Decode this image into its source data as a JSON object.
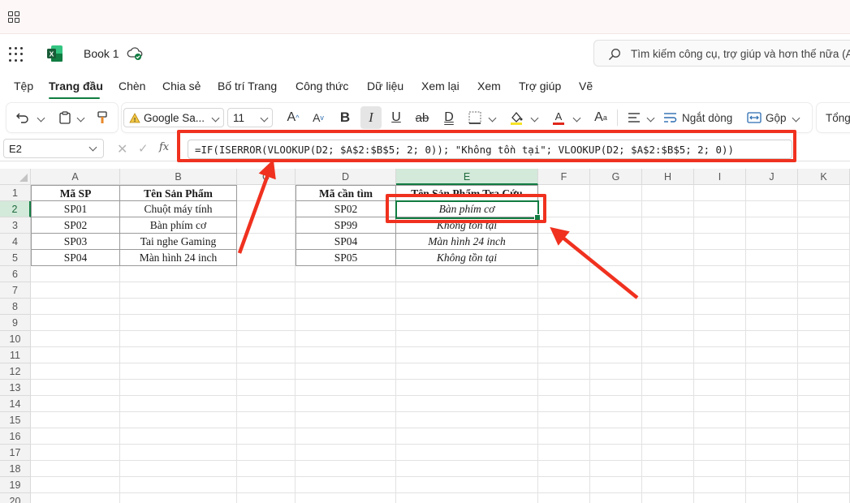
{
  "app": {
    "book_name": "Book 1",
    "search_placeholder": "Tìm kiếm công cụ, trợ giúp và hơn thế nữa (Alt + Q)"
  },
  "menu": [
    {
      "label": "Tệp"
    },
    {
      "label": "Trang đầu",
      "active": true
    },
    {
      "label": "Chèn"
    },
    {
      "label": "Chia sẻ"
    },
    {
      "label": "Bố trí Trang"
    },
    {
      "label": "Công thức"
    },
    {
      "label": "Dữ liệu"
    },
    {
      "label": "Xem lại"
    },
    {
      "label": "Xem"
    },
    {
      "label": "Trợ giúp"
    },
    {
      "label": "Vẽ"
    }
  ],
  "ribbon": {
    "font_name": "Google Sa...",
    "font_size": "11",
    "wrap_label": "Ngắt dòng",
    "merge_label": "Gộp",
    "number_format": "Tổng"
  },
  "formula_bar": {
    "name_box": "E2",
    "fx_label": "fx",
    "formula": "=IF(ISERROR(VLOOKUP(D2; $A$2:$B$5; 2; 0)); \"Không tồn tại\"; VLOOKUP(D2; $A$2:$B$5; 2; 0))"
  },
  "sheet": {
    "columns": [
      "A",
      "B",
      "C",
      "D",
      "E",
      "F",
      "G",
      "H",
      "I",
      "J",
      "K"
    ],
    "rows": [
      "1",
      "2",
      "3",
      "4",
      "5",
      "6",
      "7",
      "8",
      "9",
      "10",
      "11",
      "12",
      "13",
      "14",
      "15",
      "16",
      "17",
      "18",
      "19",
      "20"
    ],
    "selected_column": "E",
    "selected_row": "2",
    "table1_headers": [
      "Mã SP",
      "Tên Sản Phẩm"
    ],
    "table1_rows": [
      [
        "SP01",
        "Chuột máy tính"
      ],
      [
        "SP02",
        "Bàn phím cơ"
      ],
      [
        "SP03",
        "Tai nghe Gaming"
      ],
      [
        "SP04",
        "Màn hình 24 inch"
      ]
    ],
    "table2_headers": [
      "Mã cần tìm",
      "Tên Sản Phẩm Tra Cứu"
    ],
    "table2_rows": [
      [
        "SP02",
        "Bàn phím cơ"
      ],
      [
        "SP99",
        "Không tồn tại"
      ],
      [
        "SP04",
        "Màn hình 24 inch"
      ],
      [
        "SP05",
        "Không tồn tại"
      ]
    ]
  },
  "colors": {
    "accent_green": "#107c41",
    "highlight_red": "#f0311f",
    "selected_header_bg": "#d3e9da"
  },
  "icons": [
    "grid-icon",
    "app-launcher-icon",
    "excel-logo-icon",
    "cloud-sync-icon",
    "search-icon",
    "undo-icon",
    "clipboard-icon",
    "format-painter-icon",
    "warning-icon",
    "font-grow-icon",
    "font-shrink-icon",
    "bold-icon",
    "italic-icon",
    "underline-icon",
    "strikethrough-icon",
    "double-underline-icon",
    "borders-icon",
    "fill-color-icon",
    "font-color-icon",
    "font-effects-icon",
    "align-icon",
    "wrap-text-icon",
    "merge-icon",
    "close-icon",
    "check-icon",
    "arrow-icon"
  ]
}
